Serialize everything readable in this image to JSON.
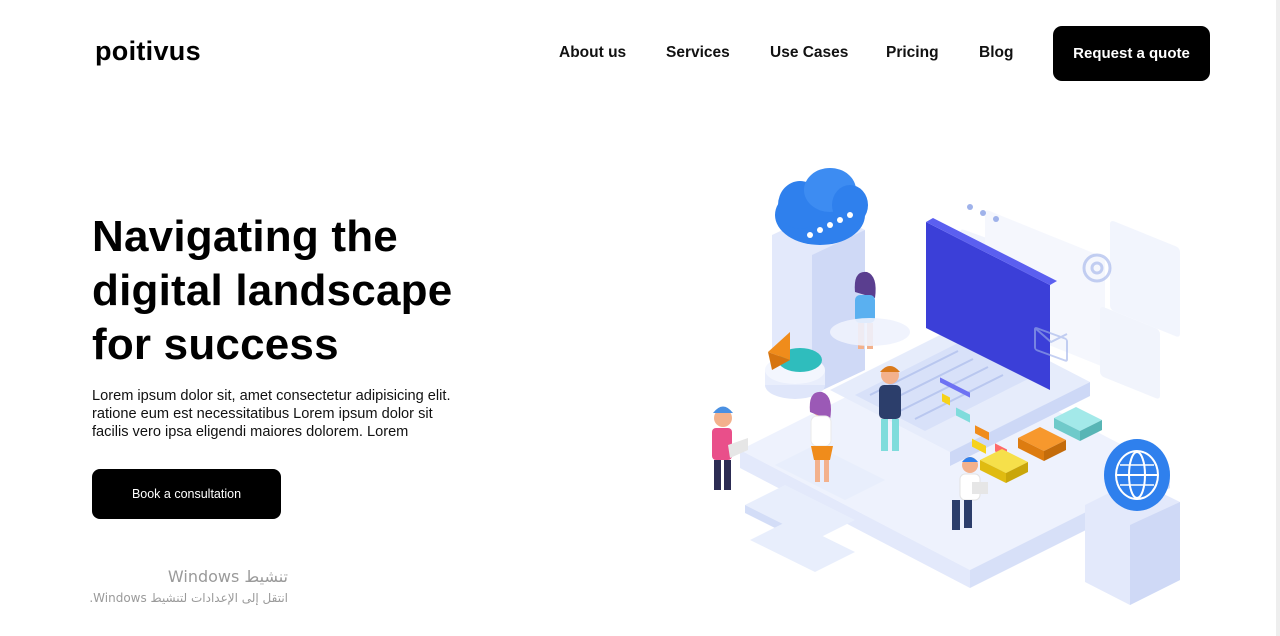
{
  "brand": {
    "logo": "poitivus"
  },
  "nav": {
    "items": [
      "About us",
      "Services",
      "Use Cases",
      "Pricing",
      "Blog"
    ],
    "cta": "Request a quote"
  },
  "hero": {
    "title_lines": [
      "Navigating the",
      "digital landscape",
      "for success"
    ],
    "text_lines": [
      "Lorem ipsum dolor sit, amet consectetur adipisicing elit.",
      "ratione eum est necessitatibus Lorem ipsum dolor sit",
      "facilis vero ipsa eligendi maiores dolorem. Lorem"
    ],
    "button": "Book a consultation"
  },
  "watermark": {
    "title": "تنشيط Windows",
    "subtitle": "انتقل إلى الإعدادات لتنشيط Windows."
  },
  "illustration": {
    "icons": [
      "cloud-icon",
      "mail-icon",
      "at-sign-icon",
      "globe-icon",
      "pie-chart-icon"
    ],
    "colors": {
      "accent_blue": "#2f80ed",
      "screen": "#3b3fd8",
      "orange": "#f08c1b",
      "yellow": "#f6d21a",
      "teal": "#7fdcdc",
      "pale": "#e6ecfb"
    }
  }
}
